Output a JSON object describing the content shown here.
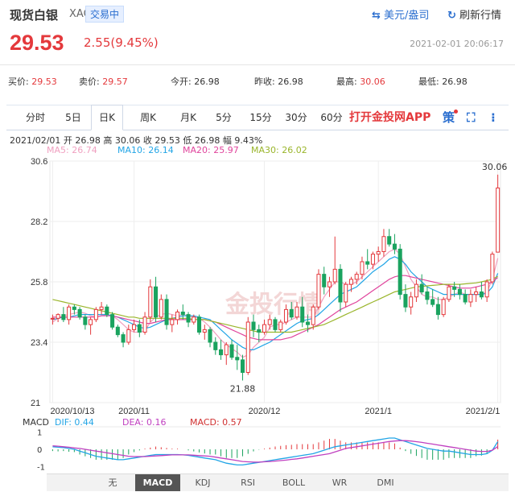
{
  "header": {
    "title": "现货白银",
    "code": "XAG",
    "status": "交易中",
    "unit_button": "美元/盎司",
    "refresh_button": "刷新行情"
  },
  "price": {
    "last": "29.53",
    "change": "2.55(9.45%)",
    "time": "2021-02-01 20:06:17"
  },
  "quotes": [
    {
      "label": "买价:",
      "value": "29.53",
      "red": true
    },
    {
      "label": "卖价:",
      "value": "29.57",
      "red": true
    },
    {
      "label": "今开:",
      "value": "26.98",
      "red": false
    },
    {
      "label": "昨收:",
      "value": "26.98",
      "red": false
    },
    {
      "label": "最高:",
      "value": "30.06",
      "red": true
    },
    {
      "label": "最低:",
      "value": "26.98",
      "red": false
    }
  ],
  "tabs": [
    "分时",
    "5日",
    "日K",
    "周K",
    "月K",
    "5分",
    "15分",
    "30分",
    "60分"
  ],
  "active_tab": 2,
  "app_link": "打开金投网APP",
  "info_line": "2021/02/01  开 26.98  高 30.06  收 29.53  低 26.98  幅 9.43%",
  "ma": [
    {
      "label": "MA5: 26.74",
      "color": "#f0a0c0"
    },
    {
      "label": "MA10: 26.14",
      "color": "#22a5e6"
    },
    {
      "label": "MA20: 25.97",
      "color": "#e0449c"
    },
    {
      "label": "MA30: 26.02",
      "color": "#9ab52b"
    }
  ],
  "watermark": "金投行情",
  "macd_legend": {
    "name": "MACD",
    "dif": "DIF: 0.44",
    "dea": "DEA: 0.16",
    "macd": "MACD: 0.57",
    "dif_color": "#22a5e6",
    "dea_color": "#c040c0",
    "macd_color": "#d03030"
  },
  "bottom_tabs": [
    "无",
    "MACD",
    "KDJ",
    "RSI",
    "BOLL",
    "WR",
    "DMI"
  ],
  "bottom_active": 1,
  "chart_data": {
    "type": "candlestick",
    "y_ticks": [
      "30.6",
      "28.2",
      "25.8",
      "23.4",
      "21"
    ],
    "ylim": [
      21,
      30.6
    ],
    "x_labels": [
      "2020/10/13",
      "2020/11",
      "2020/12",
      "2021/1",
      "2021/2/1"
    ],
    "x_label_index": [
      0,
      15,
      39,
      60,
      82
    ],
    "max_label": "30.06",
    "min_label": "21.88",
    "macd_ticks": [
      "1",
      "0",
      "-1"
    ],
    "macd_ylim": [
      -1.3,
      1.3
    ],
    "candles": [
      [
        24.35,
        24.5,
        24.1,
        24.35
      ],
      [
        24.35,
        24.55,
        24.2,
        24.5
      ],
      [
        24.5,
        24.8,
        24.2,
        24.3
      ],
      [
        24.3,
        24.9,
        24.1,
        24.8
      ],
      [
        24.8,
        24.9,
        24.5,
        24.7
      ],
      [
        24.7,
        24.8,
        24.3,
        24.4
      ],
      [
        24.4,
        24.5,
        23.9,
        24.1
      ],
      [
        24.1,
        24.4,
        23.7,
        24.3
      ],
      [
        24.3,
        24.8,
        24.2,
        24.7
      ],
      [
        24.7,
        25.0,
        24.5,
        24.8
      ],
      [
        24.8,
        24.9,
        24.4,
        24.5
      ],
      [
        24.5,
        24.6,
        23.9,
        24.0
      ],
      [
        24.0,
        24.1,
        23.6,
        23.7
      ],
      [
        23.7,
        23.8,
        23.2,
        23.4
      ],
      [
        23.4,
        24.1,
        23.3,
        23.9
      ],
      [
        23.9,
        24.3,
        23.8,
        24.1
      ],
      [
        24.1,
        24.3,
        23.6,
        23.8
      ],
      [
        23.8,
        24.6,
        23.7,
        24.4
      ],
      [
        24.4,
        25.9,
        24.2,
        25.6
      ],
      [
        25.6,
        26.0,
        24.2,
        24.4
      ],
      [
        24.4,
        25.3,
        24.3,
        25.1
      ],
      [
        25.1,
        25.3,
        23.9,
        24.1
      ],
      [
        24.1,
        24.5,
        23.8,
        24.3
      ],
      [
        24.3,
        24.7,
        24.1,
        24.6
      ],
      [
        24.6,
        24.9,
        24.3,
        24.5
      ],
      [
        24.5,
        24.6,
        24.0,
        24.2
      ],
      [
        24.2,
        24.5,
        24.1,
        24.4
      ],
      [
        24.4,
        24.5,
        23.7,
        23.8
      ],
      [
        23.8,
        24.1,
        23.5,
        23.9
      ],
      [
        23.9,
        24.0,
        23.2,
        23.4
      ],
      [
        23.4,
        23.6,
        22.9,
        23.1
      ],
      [
        23.1,
        23.5,
        22.7,
        22.9
      ],
      [
        22.9,
        23.4,
        22.5,
        23.3
      ],
      [
        23.3,
        23.5,
        22.7,
        22.8
      ],
      [
        22.8,
        23.3,
        22.3,
        22.7
      ],
      [
        22.7,
        22.9,
        21.88,
        22.2
      ],
      [
        22.2,
        24.4,
        22.1,
        24.2
      ],
      [
        24.2,
        24.5,
        23.6,
        23.9
      ],
      [
        23.9,
        24.1,
        23.4,
        23.8
      ],
      [
        23.8,
        24.3,
        23.7,
        24.1
      ],
      [
        24.1,
        24.5,
        23.9,
        24.3
      ],
      [
        24.3,
        24.4,
        23.8,
        23.9
      ],
      [
        23.9,
        24.3,
        23.8,
        24.2
      ],
      [
        24.2,
        24.9,
        24.1,
        24.7
      ],
      [
        24.7,
        25.0,
        24.3,
        24.4
      ],
      [
        24.4,
        25.0,
        24.3,
        24.8
      ],
      [
        24.8,
        25.2,
        24.0,
        24.2
      ],
      [
        24.2,
        24.5,
        23.8,
        24.1
      ],
      [
        24.1,
        24.9,
        23.9,
        24.8
      ],
      [
        24.8,
        26.3,
        24.7,
        26.1
      ],
      [
        26.1,
        26.4,
        25.3,
        25.6
      ],
      [
        25.6,
        26.0,
        25.2,
        25.8
      ],
      [
        25.8,
        27.6,
        25.7,
        26.3
      ],
      [
        26.3,
        26.5,
        24.6,
        25.0
      ],
      [
        25.0,
        25.8,
        24.8,
        25.7
      ],
      [
        25.7,
        26.0,
        25.4,
        25.9
      ],
      [
        25.9,
        26.2,
        25.7,
        26.1
      ],
      [
        26.1,
        26.8,
        25.9,
        26.6
      ],
      [
        26.6,
        27.1,
        26.3,
        26.5
      ],
      [
        26.5,
        27.0,
        26.3,
        26.9
      ],
      [
        26.9,
        27.2,
        26.6,
        27.0
      ],
      [
        27.0,
        27.9,
        26.8,
        27.6
      ],
      [
        27.6,
        27.9,
        27.2,
        27.3
      ],
      [
        27.3,
        27.7,
        26.9,
        27.1
      ],
      [
        27.1,
        27.3,
        25.1,
        25.3
      ],
      [
        25.3,
        25.7,
        24.6,
        24.8
      ],
      [
        24.8,
        25.4,
        24.5,
        25.2
      ],
      [
        25.2,
        25.9,
        25.0,
        25.7
      ],
      [
        25.7,
        26.1,
        25.3,
        25.4
      ],
      [
        25.4,
        25.6,
        24.9,
        25.1
      ],
      [
        25.1,
        25.5,
        24.8,
        24.9
      ],
      [
        24.9,
        25.2,
        24.3,
        24.5
      ],
      [
        24.5,
        25.2,
        24.4,
        25.1
      ],
      [
        25.1,
        25.7,
        25.0,
        25.6
      ],
      [
        25.6,
        25.8,
        25.2,
        25.5
      ],
      [
        25.5,
        25.7,
        25.1,
        25.3
      ],
      [
        25.3,
        25.5,
        24.9,
        25.0
      ],
      [
        25.0,
        25.5,
        24.8,
        25.3
      ],
      [
        25.3,
        25.6,
        25.0,
        25.4
      ],
      [
        25.4,
        25.8,
        25.1,
        25.2
      ],
      [
        25.2,
        25.9,
        25.0,
        25.8
      ],
      [
        25.8,
        27.0,
        25.7,
        26.9
      ],
      [
        26.98,
        30.06,
        26.98,
        29.53
      ]
    ],
    "ma_lines": [
      {
        "name": "MA5",
        "color": "#f0a0c0",
        "values": [
          24.2,
          24.35,
          24.45,
          24.5,
          24.55,
          24.6,
          24.55,
          24.45,
          24.4,
          24.45,
          24.5,
          24.45,
          24.3,
          24.1,
          23.9,
          23.8,
          23.8,
          23.85,
          24.2,
          24.4,
          24.5,
          24.55,
          24.5,
          24.45,
          24.5,
          24.45,
          24.4,
          24.35,
          24.2,
          24.0,
          23.75,
          23.5,
          23.3,
          23.15,
          23.0,
          22.8,
          22.9,
          23.2,
          23.4,
          23.6,
          24.0,
          24.1,
          24.1,
          24.2,
          24.3,
          24.4,
          24.4,
          24.4,
          24.4,
          24.8,
          25.2,
          25.5,
          25.8,
          25.8,
          25.7,
          25.7,
          25.8,
          26.0,
          26.2,
          26.4,
          26.6,
          26.8,
          27.0,
          27.1,
          26.9,
          26.4,
          25.9,
          25.6,
          25.3,
          25.2,
          25.2,
          25.1,
          25.1,
          25.2,
          25.3,
          25.4,
          25.3,
          25.3,
          25.3,
          25.3,
          25.4,
          25.9,
          26.74
        ]
      },
      {
        "name": "MA10",
        "color": "#22a5e6",
        "values": [
          24.3,
          24.35,
          24.4,
          24.4,
          24.45,
          24.5,
          24.5,
          24.5,
          24.5,
          24.5,
          24.5,
          24.45,
          24.4,
          24.3,
          24.2,
          24.1,
          24.0,
          23.95,
          24.0,
          24.1,
          24.2,
          24.3,
          24.35,
          24.4,
          24.45,
          24.45,
          24.45,
          24.4,
          24.35,
          24.3,
          24.1,
          23.9,
          23.7,
          23.5,
          23.35,
          23.2,
          23.1,
          23.1,
          23.2,
          23.3,
          23.4,
          23.55,
          23.7,
          23.85,
          24.0,
          24.15,
          24.25,
          24.3,
          24.35,
          24.5,
          24.7,
          24.9,
          25.1,
          25.3,
          25.4,
          25.5,
          25.6,
          25.8,
          26.0,
          26.2,
          26.35,
          26.5,
          26.7,
          26.8,
          26.7,
          26.5,
          26.2,
          26.0,
          25.8,
          25.6,
          25.5,
          25.4,
          25.3,
          25.3,
          25.3,
          25.3,
          25.3,
          25.3,
          25.3,
          25.3,
          25.35,
          25.6,
          26.14
        ]
      },
      {
        "name": "MA20",
        "color": "#e0449c",
        "values": [
          24.4,
          24.4,
          24.4,
          24.4,
          24.4,
          24.4,
          24.4,
          24.4,
          24.4,
          24.45,
          24.45,
          24.45,
          24.4,
          24.35,
          24.3,
          24.25,
          24.2,
          24.15,
          24.15,
          24.2,
          24.25,
          24.3,
          24.3,
          24.3,
          24.3,
          24.3,
          24.3,
          24.3,
          24.3,
          24.25,
          24.2,
          24.1,
          24.0,
          23.9,
          23.8,
          23.7,
          23.6,
          23.55,
          23.5,
          23.5,
          23.5,
          23.5,
          23.5,
          23.55,
          23.6,
          23.7,
          23.8,
          23.9,
          24.0,
          24.1,
          24.25,
          24.4,
          24.55,
          24.7,
          24.8,
          24.9,
          25.0,
          25.15,
          25.3,
          25.45,
          25.6,
          25.75,
          25.9,
          26.0,
          26.05,
          26.05,
          26.0,
          25.95,
          25.9,
          25.85,
          25.8,
          25.75,
          25.7,
          25.65,
          25.6,
          25.55,
          25.55,
          25.55,
          25.6,
          25.65,
          25.7,
          25.8,
          25.97
        ]
      },
      {
        "name": "MA30",
        "color": "#9ab52b",
        "values": [
          25.1,
          25.05,
          25.0,
          24.95,
          24.9,
          24.85,
          24.8,
          24.75,
          24.7,
          24.65,
          24.6,
          24.55,
          24.5,
          24.45,
          24.4,
          24.4,
          24.35,
          24.35,
          24.35,
          24.35,
          24.35,
          24.35,
          24.35,
          24.35,
          24.35,
          24.35,
          24.3,
          24.3,
          24.3,
          24.25,
          24.2,
          24.15,
          24.1,
          24.05,
          24.0,
          23.95,
          23.9,
          23.85,
          23.8,
          23.8,
          23.8,
          23.8,
          23.8,
          23.8,
          23.8,
          23.85,
          23.9,
          23.95,
          24.0,
          24.05,
          24.1,
          24.2,
          24.3,
          24.4,
          24.5,
          24.6,
          24.7,
          24.8,
          24.9,
          25.0,
          25.1,
          25.2,
          25.3,
          25.4,
          25.45,
          25.5,
          25.55,
          25.6,
          25.62,
          25.64,
          25.66,
          25.68,
          25.7,
          25.7,
          25.7,
          25.7,
          25.72,
          25.74,
          25.76,
          25.8,
          25.85,
          25.9,
          26.02
        ]
      }
    ],
    "dif": [
      0.15,
      0.12,
      0.1,
      0.05,
      0.0,
      -0.1,
      -0.2,
      -0.3,
      -0.4,
      -0.45,
      -0.5,
      -0.55,
      -0.6,
      -0.6,
      -0.55,
      -0.5,
      -0.45,
      -0.4,
      -0.35,
      -0.3,
      -0.3,
      -0.3,
      -0.3,
      -0.3,
      -0.32,
      -0.35,
      -0.4,
      -0.45,
      -0.5,
      -0.55,
      -0.6,
      -0.7,
      -0.8,
      -0.85,
      -0.9,
      -0.9,
      -0.85,
      -0.8,
      -0.75,
      -0.7,
      -0.65,
      -0.6,
      -0.55,
      -0.5,
      -0.45,
      -0.4,
      -0.35,
      -0.3,
      -0.25,
      -0.15,
      -0.05,
      0.05,
      0.15,
      0.2,
      0.25,
      0.3,
      0.35,
      0.4,
      0.45,
      0.5,
      0.55,
      0.6,
      0.65,
      0.65,
      0.55,
      0.45,
      0.35,
      0.25,
      0.15,
      0.05,
      0.0,
      -0.05,
      -0.1,
      -0.1,
      -0.15,
      -0.2,
      -0.25,
      -0.3,
      -0.3,
      -0.3,
      -0.25,
      -0.05,
      0.44
    ],
    "dea": [
      0.2,
      0.18,
      0.15,
      0.12,
      0.08,
      0.05,
      0.0,
      -0.05,
      -0.1,
      -0.15,
      -0.2,
      -0.25,
      -0.3,
      -0.35,
      -0.4,
      -0.42,
      -0.42,
      -0.42,
      -0.4,
      -0.38,
      -0.36,
      -0.34,
      -0.32,
      -0.32,
      -0.32,
      -0.32,
      -0.34,
      -0.36,
      -0.38,
      -0.4,
      -0.45,
      -0.5,
      -0.55,
      -0.6,
      -0.65,
      -0.7,
      -0.72,
      -0.74,
      -0.74,
      -0.72,
      -0.7,
      -0.68,
      -0.65,
      -0.62,
      -0.58,
      -0.55,
      -0.5,
      -0.45,
      -0.4,
      -0.35,
      -0.3,
      -0.25,
      -0.15,
      -0.05,
      0.05,
      0.1,
      0.15,
      0.2,
      0.25,
      0.3,
      0.35,
      0.4,
      0.45,
      0.48,
      0.5,
      0.5,
      0.48,
      0.44,
      0.4,
      0.35,
      0.3,
      0.25,
      0.2,
      0.15,
      0.1,
      0.05,
      0.0,
      -0.05,
      -0.1,
      -0.12,
      -0.12,
      -0.05,
      0.16
    ]
  }
}
